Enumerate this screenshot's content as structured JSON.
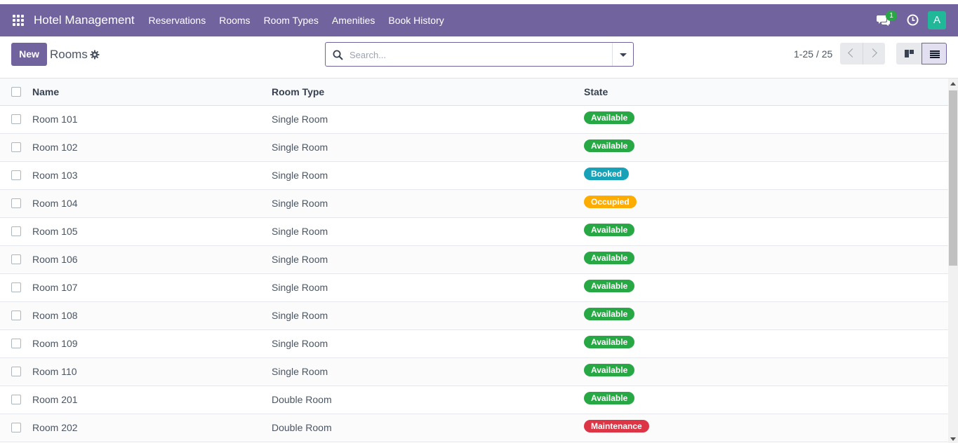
{
  "navbar": {
    "brand": "Hotel Management",
    "menu": [
      "Reservations",
      "Rooms",
      "Room Types",
      "Amenities",
      "Book History"
    ],
    "chat_count": "1",
    "avatar_letter": "A",
    "background_color": "#71639e",
    "icons": {
      "apps": "apps-grid-icon",
      "chat": "chat-bubbles-icon",
      "activity": "clock-icon"
    }
  },
  "control_panel": {
    "new_label": "New",
    "title": "Rooms",
    "search_placeholder": "Search...",
    "pager": "1-25 / 25"
  },
  "table": {
    "headers": [
      "Name",
      "Room Type",
      "State"
    ],
    "rows": [
      {
        "name": "Room 101",
        "type": "Single Room",
        "state": "Available"
      },
      {
        "name": "Room 102",
        "type": "Single Room",
        "state": "Available"
      },
      {
        "name": "Room 103",
        "type": "Single Room",
        "state": "Booked"
      },
      {
        "name": "Room 104",
        "type": "Single Room",
        "state": "Occupied"
      },
      {
        "name": "Room 105",
        "type": "Single Room",
        "state": "Available"
      },
      {
        "name": "Room 106",
        "type": "Single Room",
        "state": "Available"
      },
      {
        "name": "Room 107",
        "type": "Single Room",
        "state": "Available"
      },
      {
        "name": "Room 108",
        "type": "Single Room",
        "state": "Available"
      },
      {
        "name": "Room 109",
        "type": "Single Room",
        "state": "Available"
      },
      {
        "name": "Room 110",
        "type": "Single Room",
        "state": "Available"
      },
      {
        "name": "Room 201",
        "type": "Double Room",
        "state": "Available"
      },
      {
        "name": "Room 202",
        "type": "Double Room",
        "state": "Maintenance"
      }
    ]
  },
  "state_colors": {
    "Available": "#28a745",
    "Booked": "#17a2b8",
    "Occupied": "#ffac00",
    "Maintenance": "#dc3545"
  }
}
